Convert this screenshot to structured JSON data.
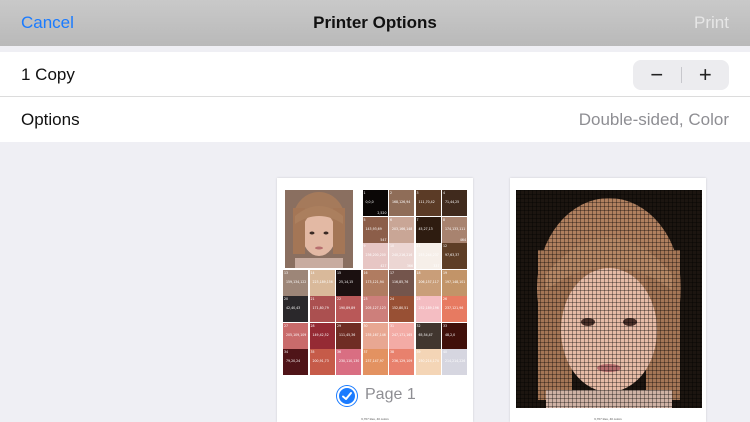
{
  "nav": {
    "cancel": "Cancel",
    "title": "Printer Options",
    "print": "Print"
  },
  "copies": {
    "label": "1 Copy",
    "minus": "−",
    "plus": "+"
  },
  "options": {
    "label": "Options",
    "value": "Double-sided, Color"
  },
  "preview": {
    "page1_label": "Page 1",
    "footer1": "6,767 tiles, 40 colors",
    "footer2": "6,767 tiles, 40 colors",
    "swatches": [
      {
        "n": "1",
        "rgb": "0,0,0",
        "c": "2,520",
        "color": "#0b0706"
      },
      {
        "n": "2",
        "rgb": "168,126,94",
        "c": "",
        "color": "#8f6d58"
      },
      {
        "n": "3",
        "rgb": "111,70,42",
        "c": "",
        "color": "#5b3b26"
      },
      {
        "n": "4",
        "rgb": "71,44,25",
        "c": "",
        "color": "#402a1d"
      },
      {
        "n": "5",
        "rgb": "143,93,69",
        "c": "547",
        "color": "#8c5e49"
      },
      {
        "n": "6",
        "rgb": "203,166,148",
        "c": "",
        "color": "#c9a696"
      },
      {
        "n": "7",
        "rgb": "45,27,13",
        "c": "",
        "color": "#2e1c10"
      },
      {
        "n": "8",
        "rgb": "174,133,111",
        "c": "464",
        "color": "#a8836f"
      },
      {
        "n": "9",
        "rgb": "236,200,200",
        "c": "427",
        "color": "#e7c6c4"
      },
      {
        "n": "10",
        "rgb": "240,216,216",
        "c": "366",
        "color": "#ecd6d3"
      },
      {
        "n": "11",
        "rgb": "253,244,237",
        "c": "337",
        "color": "#f6efe9"
      },
      {
        "n": "12",
        "rgb": "97,63,37",
        "c": "",
        "color": "#5e3e26"
      },
      {
        "n": "13",
        "rgb": "159,134,122",
        "c": "",
        "color": "#9d8678"
      },
      {
        "n": "14",
        "rgb": "223,189,156",
        "c": "",
        "color": "#d9b99a"
      },
      {
        "n": "15",
        "rgb": "25,14,15",
        "c": "",
        "color": "#1b1010"
      },
      {
        "n": "16",
        "rgb": "173,121,94",
        "c": "",
        "color": "#b07c61"
      },
      {
        "n": "17",
        "rgb": "116,85,76",
        "c": "",
        "color": "#74554c"
      },
      {
        "n": "18",
        "rgb": "206,157,117",
        "c": "",
        "color": "#c99e79"
      },
      {
        "n": "19",
        "rgb": "197,148,101",
        "c": "",
        "color": "#c29468"
      },
      {
        "n": "20",
        "rgb": "42,40,43",
        "c": "",
        "color": "#2a282b"
      },
      {
        "n": "21",
        "rgb": "171,80,79",
        "c": "",
        "color": "#ab5050"
      },
      {
        "n": "22",
        "rgb": "190,89,89",
        "c": "",
        "color": "#b95858"
      },
      {
        "n": "23",
        "rgb": "205,127,123",
        "c": "",
        "color": "#cd7f7b"
      },
      {
        "n": "24",
        "rgb": "152,80,51",
        "c": "",
        "color": "#985034"
      },
      {
        "n": "25",
        "rgb": "252,189,196",
        "c": "",
        "color": "#f4bdc2"
      },
      {
        "n": "26",
        "rgb": "237,121,96",
        "c": "",
        "color": "#e77a61"
      },
      {
        "n": "27",
        "rgb": "205,109,109",
        "c": "",
        "color": "#c96b6b"
      },
      {
        "n": "28",
        "rgb": "149,42,52",
        "c": "",
        "color": "#952a34"
      },
      {
        "n": "29",
        "rgb": "111,45,36",
        "c": "",
        "color": "#6f2d24"
      },
      {
        "n": "30",
        "rgb": "235,167,146",
        "c": "",
        "color": "#e8a792"
      },
      {
        "n": "31",
        "rgb": "247,171,165",
        "c": "",
        "color": "#f3aba5"
      },
      {
        "n": "32",
        "rgb": "65,54,47",
        "c": "",
        "color": "#41362f"
      },
      {
        "n": "33",
        "rgb": "48,2,0",
        "c": "",
        "color": "#40100a"
      },
      {
        "n": "34",
        "rgb": "79,20,24",
        "c": "",
        "color": "#4f1418"
      },
      {
        "n": "35",
        "rgb": "200,91,73",
        "c": "",
        "color": "#c65b49"
      },
      {
        "n": "36",
        "rgb": "230,110,130",
        "c": "",
        "color": "#d96e82"
      },
      {
        "n": "37",
        "rgb": "237,147,97",
        "c": "",
        "color": "#e39261"
      },
      {
        "n": "38",
        "rgb": "236,129,109",
        "c": "",
        "color": "#e8816d"
      },
      {
        "n": "39",
        "rgb": "250,214,174",
        "c": "",
        "color": "#f4d5b6"
      },
      {
        "n": "40",
        "rgb": "214,214,226",
        "c": "",
        "color": "#d6d6e0"
      }
    ]
  },
  "colors": {
    "accent": "#1a7bff",
    "muted": "#8e8e93"
  }
}
